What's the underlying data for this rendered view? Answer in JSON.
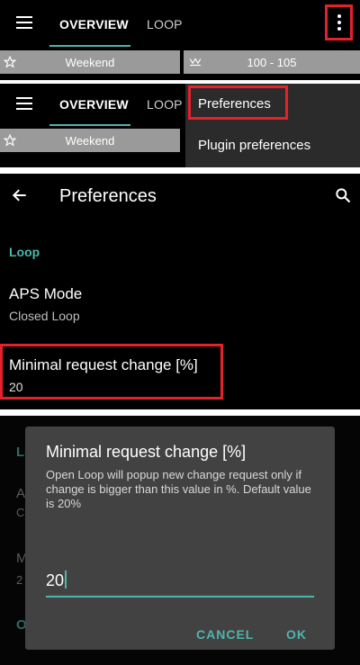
{
  "panel1": {
    "tabs": [
      "OVERVIEW",
      "LOOP"
    ],
    "chips": {
      "profile": "Weekend",
      "target": "100 - 105"
    }
  },
  "panel2": {
    "tabs": [
      "OVERVIEW",
      "LOOP"
    ],
    "chips": {
      "profile": "Weekend"
    },
    "menu": [
      "Preferences",
      "Plugin preferences"
    ]
  },
  "panel3": {
    "title": "Preferences",
    "section": "Loop",
    "aps_mode": {
      "label": "APS Mode",
      "value": "Closed Loop"
    },
    "min_request": {
      "label": "Minimal request change [%]",
      "value": "20"
    }
  },
  "panel4": {
    "bg_letters": [
      "Lo",
      "A",
      "C",
      "M",
      "2",
      "O"
    ],
    "dialog": {
      "title": "Minimal request change [%]",
      "message": "Open Loop will popup new change request only if change is bigger than this value in %. Default value is 20%",
      "input_value": "20",
      "cancel": "CANCEL",
      "ok": "OK"
    }
  },
  "colors": {
    "accent": "#4db6ac",
    "highlight": "#e5212c",
    "chip": "#9a9a9a"
  }
}
